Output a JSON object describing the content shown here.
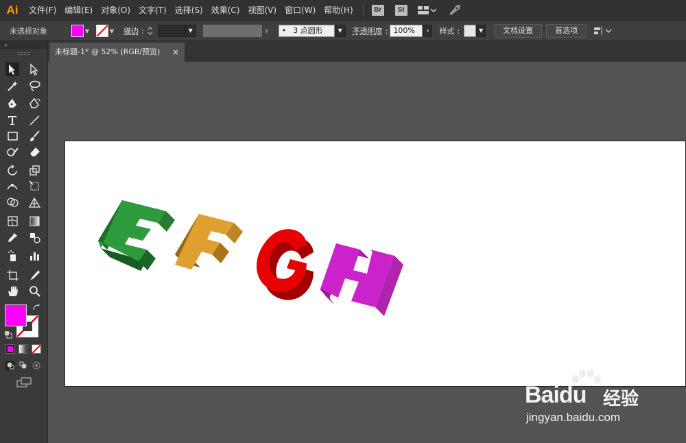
{
  "app": {
    "logo": "Ai",
    "menu": [
      "文件(F)",
      "编辑(E)",
      "对象(O)",
      "文字(T)",
      "选择(S)",
      "效果(C)",
      "视图(V)",
      "窗口(W)",
      "帮助(H)"
    ],
    "bridge_label": "Br",
    "stock_label": "St"
  },
  "control": {
    "selection_label": "未选择对象",
    "fill_color": "#ff00ff",
    "stroke_label": "描边",
    "stroke_colon": ":",
    "brush_value": "3 点圆形",
    "brush_dot": "•",
    "opacity_label": "不透明度",
    "opacity_value": "100%",
    "style_label": "样式",
    "doc_setup_button": "文档设置",
    "prefs_button": "首选项"
  },
  "document": {
    "tab_title": "未标题-1* @ 52% (RGB/预览)",
    "close_glyph": "×"
  },
  "artwork": {
    "letters": [
      {
        "char": "E",
        "color": "#2e9a3e"
      },
      {
        "char": "F",
        "color": "#e0a030"
      },
      {
        "char": "G",
        "color": "#e60000"
      },
      {
        "char": "H",
        "color": "#cc22cc"
      }
    ]
  },
  "toolbar": {
    "fill_color": "#ff00ff"
  },
  "watermark": {
    "brand_a": "Bai",
    "brand_b": "du",
    "brand_cn": "经验",
    "url": "jingyan.baidu.com"
  }
}
